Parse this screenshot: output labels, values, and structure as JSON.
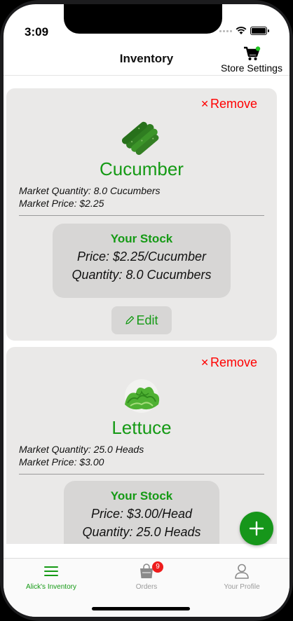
{
  "status_bar": {
    "time": "3:09"
  },
  "header": {
    "title": "Inventory",
    "store_settings_label": "Store Settings"
  },
  "cards": [
    {
      "remove_label": "Remove",
      "name": "Cucumber",
      "image_icon": "cucumber-image",
      "market_quantity": "Market Quantity: 8.0 Cucumbers",
      "market_price": "Market Price: $2.25",
      "stock_title": "Your Stock",
      "stock_price": "Price: $2.25/Cucumber",
      "stock_quantity": "Quantity: 8.0 Cucumbers",
      "edit_label": "Edit"
    },
    {
      "remove_label": "Remove",
      "name": "Lettuce",
      "image_icon": "lettuce-image",
      "market_quantity": "Market Quantity: 25.0 Heads",
      "market_price": "Market Price: $3.00",
      "stock_title": "Your Stock",
      "stock_price": "Price: $3.00/Head",
      "stock_quantity": "Quantity: 25.0 Heads"
    }
  ],
  "tabs": [
    {
      "label": "Alick's Inventory",
      "icon": "hamburger-menu-icon",
      "active": true
    },
    {
      "label": "Orders",
      "icon": "shopping-bag-icon",
      "badge": "9",
      "active": false
    },
    {
      "label": "Your Profile",
      "icon": "person-icon",
      "active": false
    }
  ],
  "colors": {
    "accent_green": "#159a15",
    "remove_red": "#ff0000",
    "card_bg": "#eae9e8",
    "badge_red": "#ee1c1c"
  }
}
